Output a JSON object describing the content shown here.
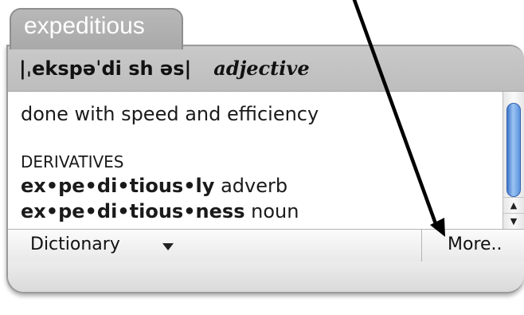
{
  "entry": {
    "word": "expeditious",
    "pronunciation": "|ˌekspəˈdi sh əs|",
    "part_of_speech": "adjective",
    "definition": "done with speed and efficiency",
    "derivatives_heading": "DERIVATIVES",
    "derivatives": [
      {
        "headword": "ex•pe•di•tious•ly",
        "pos": "adverb"
      },
      {
        "headword": "ex•pe•di•tious•ness",
        "pos": "noun"
      }
    ]
  },
  "footer": {
    "source_label": "Dictionary",
    "more_label": "More.."
  },
  "scrollbar": {
    "up_arrow": "▲",
    "down_arrow": "▼"
  },
  "colors": {
    "tab_gray": "#a9a9a9",
    "scroll_thumb_blue": "#5b93de",
    "annotation_arrow": "#000000"
  },
  "icons": {
    "source_dropdown": "chevron-down-icon",
    "annotation": "pointer-arrow-icon"
  }
}
